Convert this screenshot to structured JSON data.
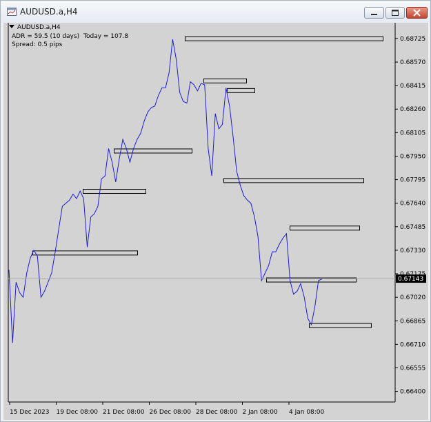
{
  "window": {
    "title": "AUDUSD.a,H4",
    "title_icon": "chart-window-icon",
    "controls": [
      "minimize-icon",
      "maximize-icon",
      "close-icon"
    ]
  },
  "info": {
    "symbol_label": "AUDUSD.a,H4",
    "adr": "ADR = 59.5  (10 days)",
    "today": "Today = 107.8",
    "spread": "Spread: 0.5 pips"
  },
  "colors": {
    "background": "#d3d3d3",
    "line": "#1c1cd8",
    "price_tag_bg": "#000000",
    "price_tag_fg": "#ffffff"
  },
  "chart_data": {
    "type": "line",
    "ylim": [
      0.6633,
      0.6882
    ],
    "y_ticks": [
      "0.68725",
      "0.68570",
      "0.68415",
      "0.68260",
      "0.68105",
      "0.67950",
      "0.67795",
      "0.67640",
      "0.67485",
      "0.67330",
      "0.67175",
      "0.67020",
      "0.66865",
      "0.66710",
      "0.66555",
      "0.66400"
    ],
    "x_tick_labels": [
      "15 Dec 2023",
      "19 Dec 08:00",
      "21 Dec 08:00",
      "26 Dec 08:00",
      "28 Dec 08:00",
      "2 Jan 08:00",
      "4 Jan 08:00"
    ],
    "current_price": "0.67143",
    "series": [
      {
        "values": [
          0.672,
          0.6672,
          0.6712,
          0.6705,
          0.6702,
          0.6718,
          0.6728,
          0.6733,
          0.6729,
          0.6702,
          0.6706,
          0.6712,
          0.6718,
          0.6732,
          0.6747,
          0.6762,
          0.6764,
          0.6766,
          0.677,
          0.6767,
          0.6772,
          0.6767,
          0.6735,
          0.6755,
          0.6757,
          0.6762,
          0.678,
          0.6782,
          0.68,
          0.6791,
          0.6778,
          0.6793,
          0.6806,
          0.68,
          0.6791,
          0.68,
          0.6806,
          0.681,
          0.6818,
          0.6824,
          0.6827,
          0.6828,
          0.6835,
          0.684,
          0.684,
          0.685,
          0.6872,
          0.6859,
          0.6837,
          0.6831,
          0.683,
          0.6844,
          0.6842,
          0.6838,
          0.6843,
          0.6842,
          0.68,
          0.6782,
          0.6823,
          0.6813,
          0.6816,
          0.684,
          0.6828,
          0.6808,
          0.6785,
          0.6776,
          0.6769,
          0.6766,
          0.6764,
          0.6755,
          0.6742,
          0.6713,
          0.6718,
          0.6723,
          0.6732,
          0.6732,
          0.6737,
          0.6741,
          0.6744,
          0.6713,
          0.6704,
          0.6706,
          0.6711,
          0.6702,
          0.6688,
          0.6684,
          0.6696,
          0.6713,
          0.6714
        ]
      }
    ],
    "zones": [
      {
        "y_top": 0.6874,
        "y_bottom": 0.68715
      },
      {
        "y_top": 0.68462,
        "y_bottom": 0.68447
      },
      {
        "y_top": 0.68398,
        "y_bottom": 0.68375
      },
      {
        "y_top": 0.68,
        "y_bottom": 0.6798
      },
      {
        "y_top": 0.67805,
        "y_bottom": 0.67785
      },
      {
        "y_top": 0.67734,
        "y_bottom": 0.67708
      },
      {
        "y_top": 0.67492,
        "y_bottom": 0.67465
      },
      {
        "y_top": 0.67328,
        "y_bottom": 0.67305
      },
      {
        "y_top": 0.6715,
        "y_bottom": 0.67133
      },
      {
        "y_top": 0.6685,
        "y_bottom": 0.66828
      }
    ]
  }
}
